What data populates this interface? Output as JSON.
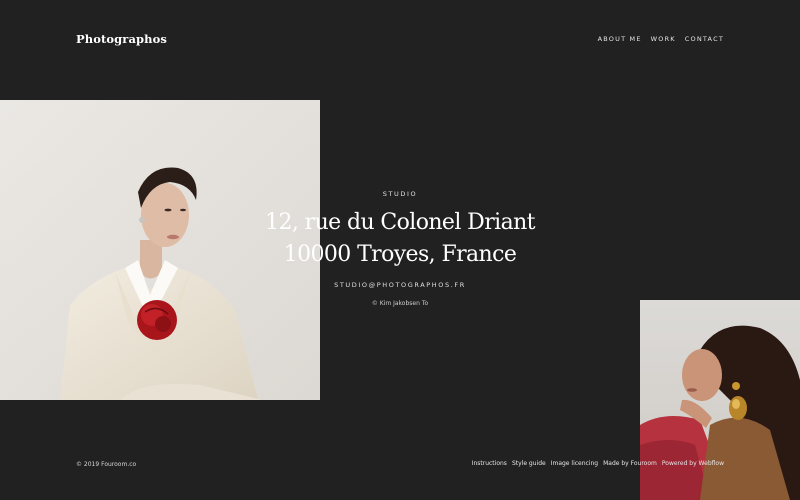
{
  "header": {
    "logo": "Photographos",
    "nav": [
      "ABOUT ME",
      "WORK",
      "CONTACT"
    ]
  },
  "studio": {
    "label": "STUDIO",
    "address_line1": "12, rue du Colonel Driant",
    "address_line2": "10000 Troyes, France",
    "email": "STUDIO@PHOTOGRAPHOS.FR",
    "credit": "© Kim Jakobsen To"
  },
  "footer": {
    "copyright": "© 2019 Fouroom.co",
    "links": [
      "Instructions",
      "Style guide",
      "Image licencing",
      "Made by Fouroom",
      "Powered by Webflow"
    ]
  },
  "colors": {
    "background": "#212121",
    "text": "#ffffff",
    "muted_text": "#e0e0e0"
  }
}
